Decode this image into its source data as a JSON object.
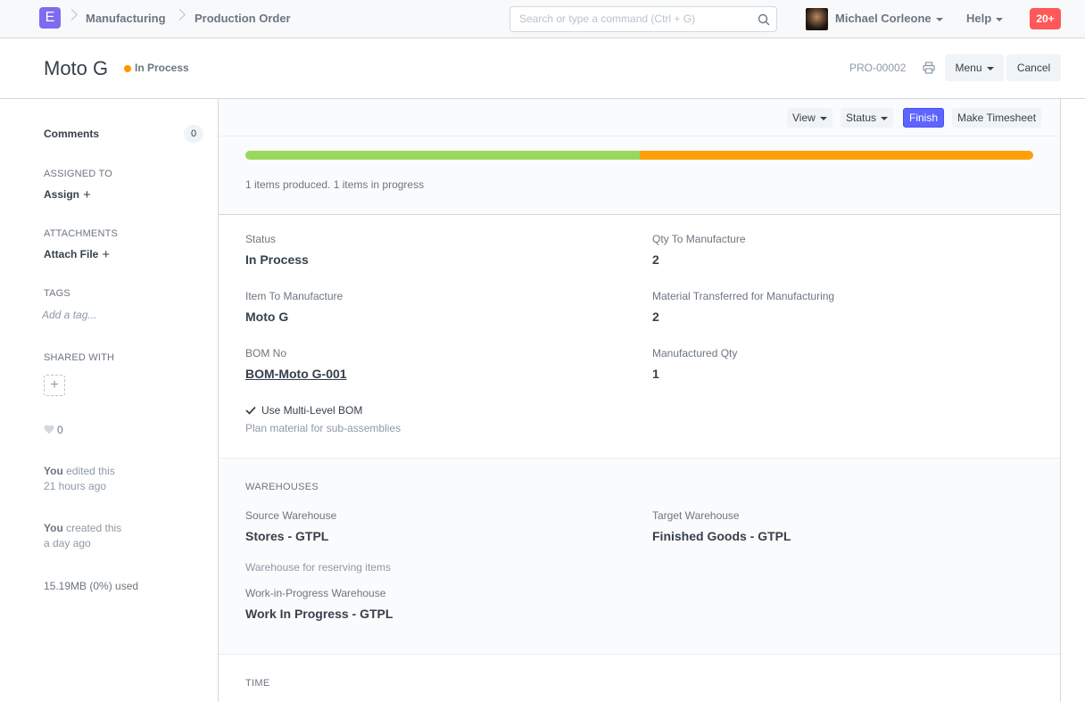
{
  "navbar": {
    "logo_letter": "E",
    "breadcrumbs": [
      "Manufacturing",
      "Production Order"
    ],
    "search_placeholder": "Search or type a command (Ctrl + G)",
    "user_name": "Michael Corleone",
    "help_label": "Help",
    "notifications": "20+"
  },
  "page_head": {
    "title": "Moto G",
    "status": "In Process",
    "status_color": "#ff9800",
    "docname": "PRO-00002",
    "menu_label": "Menu",
    "cancel_label": "Cancel"
  },
  "sidebar": {
    "comments_label": "Comments",
    "comments_count": "0",
    "assigned_to_label": "Assigned To",
    "assign_label": "Assign",
    "attachments_label": "Attachments",
    "attach_label": "Attach File",
    "tags_label": "Tags",
    "add_tag_placeholder": "Add a tag...",
    "shared_with_label": "Shared With",
    "likes": "0",
    "activity": [
      {
        "who": "You",
        "action": "edited this",
        "when": "21 hours ago"
      },
      {
        "who": "You",
        "action": "created this",
        "when": "a day ago"
      }
    ],
    "storage": "15.19MB (0%) used"
  },
  "toolbar": {
    "view_label": "View",
    "status_label": "Status",
    "finish_label": "Finish",
    "timesheet_label": "Make Timesheet"
  },
  "progress": {
    "produced_fraction": 0.5,
    "in_progress_fraction": 0.5,
    "produced_color": "#98d85b",
    "in_progress_color": "#ffa00a",
    "text": "1 items produced. 1 items in progress"
  },
  "form": {
    "status_label": "Status",
    "status_value": "In Process",
    "qty_label": "Qty To Manufacture",
    "qty_value": "2",
    "item_label": "Item To Manufacture",
    "item_value": "Moto G",
    "transferred_label": "Material Transferred for Manufacturing",
    "transferred_value": "2",
    "bom_label": "BOM No",
    "bom_value": "BOM-Moto G-001",
    "manufactured_label": "Manufactured Qty",
    "manufactured_value": "1",
    "multi_level_label": "Use Multi-Level BOM",
    "multi_level_desc": "Plan material for sub-assemblies"
  },
  "warehouses": {
    "heading": "Warehouses",
    "source_label": "Source Warehouse",
    "source_value": "Stores - GTPL",
    "target_label": "Target Warehouse",
    "target_value": "Finished Goods - GTPL",
    "reserving_desc": "Warehouse for reserving items",
    "wip_label": "Work-in-Progress Warehouse",
    "wip_value": "Work In Progress - GTPL"
  },
  "time": {
    "heading": "Time"
  }
}
